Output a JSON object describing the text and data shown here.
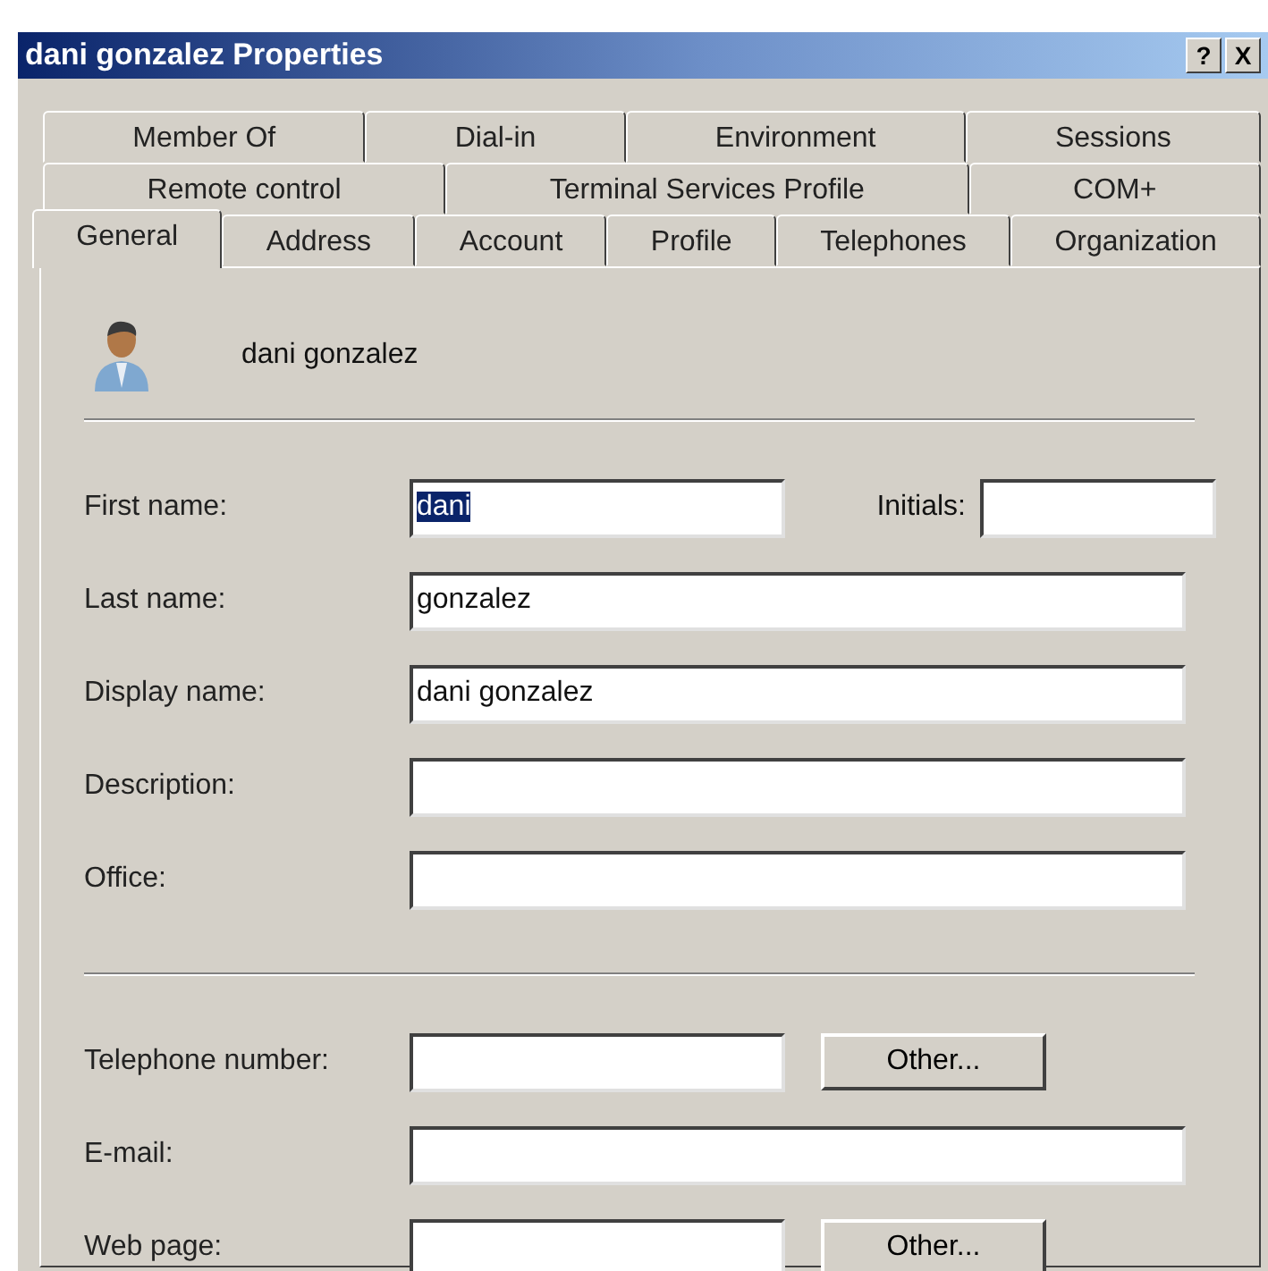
{
  "window": {
    "title": "dani gonzalez Properties",
    "buttons": [
      "?",
      "X"
    ]
  },
  "tab_rows": [
    [
      {
        "label": "Member Of",
        "selected": false
      },
      {
        "label": "Dial-in",
        "selected": false
      },
      {
        "label": "Environment",
        "selected": false
      },
      {
        "label": "Sessions",
        "selected": false
      }
    ],
    [
      {
        "label": "Remote control",
        "selected": false
      },
      {
        "label": "Terminal Services Profile",
        "selected": false
      },
      {
        "label": "COM+",
        "selected": false
      }
    ],
    [
      {
        "label": "General",
        "selected": true
      },
      {
        "label": "Address",
        "selected": false
      },
      {
        "label": "Account",
        "selected": false
      },
      {
        "label": "Profile",
        "selected": false
      },
      {
        "label": "Telephones",
        "selected": false
      },
      {
        "label": "Organization",
        "selected": false
      }
    ]
  ],
  "user": {
    "name": "dani gonzalez"
  },
  "sections": [
    [
      {
        "label": "First name:",
        "value": "dani",
        "text_selected": true,
        "extra": {
          "label": "Initials:"
        }
      },
      {
        "label": "Last name:",
        "value": "gonzalez",
        "text_selected": false
      },
      {
        "label": "Display name:",
        "value": "dani gonzalez",
        "text_selected": false
      },
      {
        "label": "Description:"
      },
      {
        "label": "Office:"
      }
    ],
    [
      {
        "label": "Telephone number:",
        "button": "Other..."
      },
      {
        "label": "E-mail:"
      },
      {
        "label": "Web page:",
        "button": "Other..."
      }
    ]
  ]
}
